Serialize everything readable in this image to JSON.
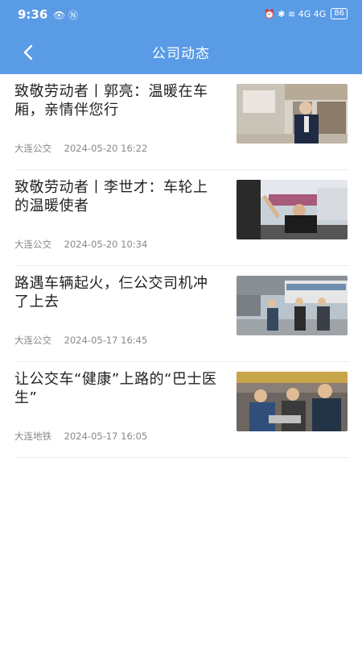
{
  "status_bar": {
    "time": "9:36",
    "left_icons": "👁 Ⓝ",
    "right_icons": "⏰ ✱ ≋ 4G 4G",
    "battery": "86"
  },
  "header": {
    "title": "公司动态",
    "back_icon": "chevron-left-icon",
    "background": "#5a9be6"
  },
  "news": [
    {
      "title": "致敬劳动者丨郭亮：温暖在车厢，亲情伴您行",
      "source": "大连公交",
      "datetime": "2024-05-20 16:22"
    },
    {
      "title": "致敬劳动者丨李世才：车轮上的温暖使者",
      "source": "大连公交",
      "datetime": "2024-05-20 10:34"
    },
    {
      "title": "路遇车辆起火，仨公交司机冲了上去",
      "source": "大连公交",
      "datetime": "2024-05-17 16:45"
    },
    {
      "title": "让公交车“健康”上路的“巴士医生”",
      "source": "大连地铁",
      "datetime": "2024-05-17 16:05"
    }
  ]
}
